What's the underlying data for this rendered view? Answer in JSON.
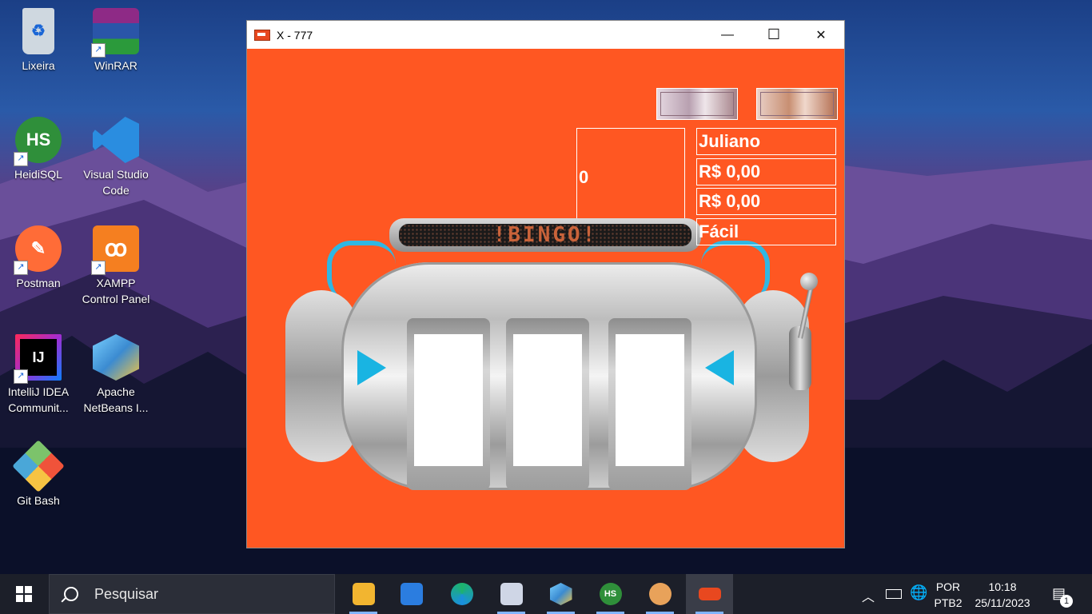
{
  "desktop": {
    "icons": [
      {
        "label": "Lixeira",
        "icon": "recycle-bin-icon",
        "color": "#cfd8e0"
      },
      {
        "label": "WinRAR",
        "icon": "winrar-icon",
        "color": "#8e2a86"
      },
      {
        "label": "HeidiSQL",
        "icon": "heidisql-icon",
        "color": "#2f8f3a",
        "glyph": "HS"
      },
      {
        "label": "Visual Studio Code",
        "icon": "vscode-icon",
        "color": "#2a8de0"
      },
      {
        "label": "Postman",
        "icon": "postman-icon",
        "color": "#ff6c37"
      },
      {
        "label": "XAMPP Control Panel",
        "icon": "xampp-icon",
        "color": "#f57f20"
      },
      {
        "label": "IntelliJ IDEA Communit...",
        "icon": "intellij-icon",
        "color": "#1a1a2a",
        "glyph": "IJ"
      },
      {
        "label": "Apache NetBeans I...",
        "icon": "netbeans-icon",
        "color": "#3b8bd1"
      },
      {
        "label": "Git Bash",
        "icon": "git-bash-icon",
        "color": "#4aa7d8"
      }
    ]
  },
  "window": {
    "title": "X -  777",
    "minimize": "—",
    "maximize": "☐",
    "close": "✕",
    "counter": "0",
    "player_name": "Juliano",
    "balance_1": "R$ 0,00",
    "balance_2": "R$ 0,00",
    "difficulty": "Fácil",
    "led_text": "!BINGO!",
    "colors": {
      "background": "#ff5722",
      "accent": "#19b4e2"
    }
  },
  "taskbar": {
    "search_placeholder": "Pesquisar",
    "apps": [
      {
        "name": "file-explorer-icon",
        "color": "#f2b530"
      },
      {
        "name": "microsoft-store-icon",
        "color": "#2b7de0"
      },
      {
        "name": "edge-icon",
        "color": "#1db36b"
      },
      {
        "name": "vpn-client-icon",
        "color": "#cfd6e6"
      },
      {
        "name": "netbeans-icon",
        "color": "#3b8bd1"
      },
      {
        "name": "heidisql-icon",
        "color": "#2f8f3a",
        "glyph": "HS"
      },
      {
        "name": "paint-icon",
        "color": "#e8a25a"
      },
      {
        "name": "slot-machine-app-icon",
        "color": "#e8481f"
      }
    ],
    "lang_top": "POR",
    "lang_bottom": "PTB2",
    "time": "10:18",
    "date": "25/11/2023",
    "notifications": "1"
  }
}
